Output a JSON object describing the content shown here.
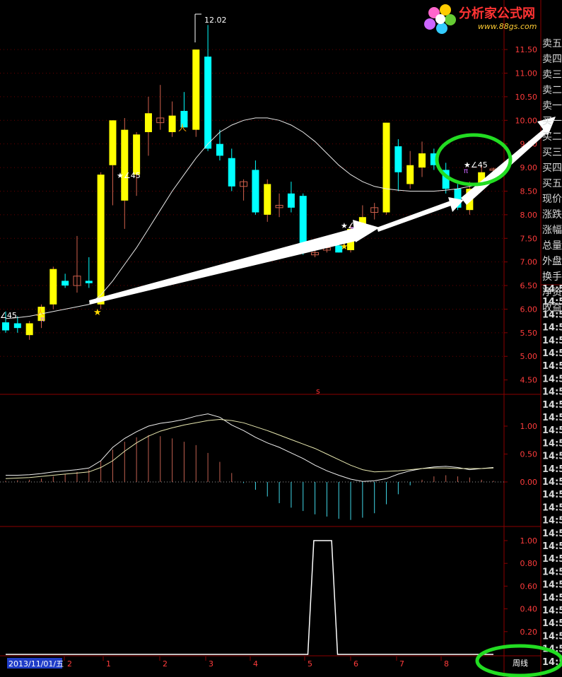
{
  "logo": {
    "title": "分析家公式网",
    "url": "www.88gs.com"
  },
  "price_axis": {
    "labels": [
      "11.50",
      "11.00",
      "10.50",
      "10.00",
      "9.50",
      "9.00",
      "8.50",
      "8.00",
      "7.50",
      "7.00",
      "6.50",
      "6.00",
      "5.50",
      "5.00",
      "4.50"
    ]
  },
  "macd_axis": {
    "labels": [
      "1.00",
      "0.50",
      "0.00"
    ]
  },
  "signal_axis": {
    "labels": [
      "1.00",
      "0.80",
      "0.60",
      "0.40",
      "0.20"
    ]
  },
  "quote_panel": {
    "labels": [
      "卖五",
      "卖四",
      "卖三",
      "卖二",
      "卖一",
      "买一",
      "买二",
      "买三",
      "买四",
      "买五",
      "现价",
      "涨跌",
      "涨幅",
      "总量",
      "外盘",
      "换手",
      "净资",
      "收益"
    ]
  },
  "time_column": {
    "label": "14:5",
    "count": 30
  },
  "annotations": {
    "high_price": "12.02",
    "angle_marks": [
      "∠45",
      "∠45",
      "∠45",
      "∠45"
    ],
    "s_marker": "s"
  },
  "time_axis": {
    "date_label": "2013/11/01/五",
    "ticks": [
      "1",
      "2",
      "1",
      "2",
      "3",
      "4",
      "5",
      "6",
      "7",
      "8"
    ]
  },
  "period_button": "周线",
  "colors": {
    "up": "#ffff00",
    "down": "#00ffff",
    "grid": "#8b0000",
    "axis_text": "#ff3c3c",
    "highlight": "#22dd22"
  },
  "chart_data": [
    {
      "type": "candlestick",
      "title": "",
      "ylim": [
        4.3,
        11.8
      ],
      "candles": [
        {
          "o": 5.72,
          "h": 5.95,
          "l": 5.5,
          "c": 5.55
        },
        {
          "o": 5.7,
          "h": 5.85,
          "l": 5.5,
          "c": 5.6
        },
        {
          "o": 5.45,
          "h": 5.75,
          "l": 5.35,
          "c": 5.7
        },
        {
          "o": 5.75,
          "h": 6.1,
          "l": 5.6,
          "c": 6.05
        },
        {
          "o": 6.1,
          "h": 6.9,
          "l": 6.0,
          "c": 6.85
        },
        {
          "o": 6.6,
          "h": 6.75,
          "l": 6.45,
          "c": 6.5
        },
        {
          "o": 6.5,
          "h": 7.55,
          "l": 6.35,
          "c": 6.7
        },
        {
          "o": 6.6,
          "h": 7.1,
          "l": 6.45,
          "c": 6.55
        },
        {
          "o": 6.1,
          "h": 8.9,
          "l": 6.0,
          "c": 8.85
        },
        {
          "o": 9.05,
          "h": 10.0,
          "l": 8.2,
          "c": 10.0
        },
        {
          "o": 8.3,
          "h": 10.05,
          "l": 7.7,
          "c": 9.8
        },
        {
          "o": 8.85,
          "h": 9.75,
          "l": 8.4,
          "c": 9.7
        },
        {
          "o": 9.75,
          "h": 10.5,
          "l": 9.25,
          "c": 10.15
        },
        {
          "o": 9.95,
          "h": 10.75,
          "l": 9.8,
          "c": 10.05
        },
        {
          "o": 9.75,
          "h": 10.4,
          "l": 9.65,
          "c": 10.1
        },
        {
          "o": 10.2,
          "h": 10.6,
          "l": 9.85,
          "c": 9.85
        },
        {
          "o": 9.8,
          "h": 11.5,
          "l": 9.65,
          "c": 11.5
        },
        {
          "o": 11.35,
          "h": 12.02,
          "l": 9.35,
          "c": 9.4
        },
        {
          "o": 9.5,
          "h": 9.8,
          "l": 9.15,
          "c": 9.25
        },
        {
          "o": 9.2,
          "h": 9.4,
          "l": 8.5,
          "c": 8.6
        },
        {
          "o": 8.6,
          "h": 8.75,
          "l": 8.3,
          "c": 8.7
        },
        {
          "o": 8.95,
          "h": 9.15,
          "l": 8.0,
          "c": 8.05
        },
        {
          "o": 8.0,
          "h": 8.75,
          "l": 7.85,
          "c": 8.65
        },
        {
          "o": 8.15,
          "h": 8.45,
          "l": 7.95,
          "c": 8.2
        },
        {
          "o": 8.45,
          "h": 8.7,
          "l": 8.05,
          "c": 8.15
        },
        {
          "o": 8.4,
          "h": 8.45,
          "l": 7.15,
          "c": 7.3
        },
        {
          "o": 7.15,
          "h": 7.25,
          "l": 7.1,
          "c": 7.2
        },
        {
          "o": 7.25,
          "h": 7.55,
          "l": 7.2,
          "c": 7.3
        },
        {
          "o": 7.35,
          "h": 7.6,
          "l": 7.2,
          "c": 7.2
        },
        {
          "o": 7.25,
          "h": 7.8,
          "l": 7.2,
          "c": 7.7
        },
        {
          "o": 7.7,
          "h": 8.2,
          "l": 7.6,
          "c": 7.95
        },
        {
          "o": 8.05,
          "h": 8.25,
          "l": 7.9,
          "c": 8.15
        },
        {
          "o": 8.05,
          "h": 9.95,
          "l": 8.0,
          "c": 9.95
        },
        {
          "o": 9.45,
          "h": 9.6,
          "l": 8.5,
          "c": 8.9
        },
        {
          "o": 8.65,
          "h": 9.35,
          "l": 8.55,
          "c": 9.05
        },
        {
          "o": 9.0,
          "h": 9.55,
          "l": 8.8,
          "c": 9.3
        },
        {
          "o": 9.3,
          "h": 9.4,
          "l": 8.95,
          "c": 9.05
        },
        {
          "o": 8.95,
          "h": 9.1,
          "l": 8.45,
          "c": 8.55
        },
        {
          "o": 8.55,
          "h": 8.65,
          "l": 8.1,
          "c": 8.15
        },
        {
          "o": 8.1,
          "h": 8.7,
          "l": 8.0,
          "c": 8.55
        },
        {
          "o": 8.65,
          "h": 9.05,
          "l": 8.5,
          "c": 8.9
        },
        {
          "o": 8.95,
          "h": 9.0,
          "l": 8.9,
          "c": 8.97
        }
      ],
      "ma": [
        5.8,
        5.82,
        5.85,
        5.9,
        5.95,
        6.0,
        6.05,
        6.1,
        6.3,
        6.6,
        6.95,
        7.3,
        7.7,
        8.1,
        8.5,
        8.85,
        9.2,
        9.5,
        9.75,
        9.9,
        10.0,
        10.05,
        10.05,
        10.0,
        9.9,
        9.75,
        9.55,
        9.3,
        9.05,
        8.85,
        8.7,
        8.6,
        8.55,
        8.52,
        8.5,
        8.5,
        8.5,
        8.52,
        8.55,
        8.6,
        8.65,
        8.7
      ]
    },
    {
      "type": "bar",
      "title": "",
      "ylim": [
        -0.75,
        1.25
      ],
      "values": [
        0.02,
        0.03,
        0.04,
        0.06,
        0.1,
        0.14,
        0.18,
        0.22,
        0.38,
        0.58,
        0.72,
        0.8,
        0.84,
        0.82,
        0.78,
        0.72,
        0.66,
        0.52,
        0.36,
        0.16,
        -0.02,
        -0.14,
        -0.26,
        -0.38,
        -0.46,
        -0.52,
        -0.58,
        -0.62,
        -0.66,
        -0.68,
        -0.64,
        -0.56,
        -0.4,
        -0.22,
        -0.06,
        0.04,
        0.1,
        0.12,
        0.1,
        0.08,
        0.04,
        0.02
      ],
      "dif": [
        0.12,
        0.12,
        0.13,
        0.15,
        0.18,
        0.2,
        0.22,
        0.25,
        0.38,
        0.62,
        0.78,
        0.9,
        1.0,
        1.05,
        1.08,
        1.12,
        1.18,
        1.22,
        1.16,
        1.02,
        0.92,
        0.8,
        0.7,
        0.62,
        0.52,
        0.42,
        0.3,
        0.2,
        0.12,
        0.05,
        0.01,
        0.02,
        0.06,
        0.14,
        0.2,
        0.24,
        0.27,
        0.28,
        0.26,
        0.22,
        0.24,
        0.26
      ],
      "dea": [
        0.06,
        0.07,
        0.08,
        0.1,
        0.12,
        0.14,
        0.16,
        0.18,
        0.26,
        0.38,
        0.55,
        0.7,
        0.82,
        0.91,
        0.97,
        1.02,
        1.06,
        1.1,
        1.12,
        1.1,
        1.06,
        0.99,
        0.92,
        0.84,
        0.76,
        0.68,
        0.6,
        0.5,
        0.4,
        0.3,
        0.22,
        0.18,
        0.19,
        0.2,
        0.22,
        0.24,
        0.25,
        0.25,
        0.24,
        0.24,
        0.24,
        0.25
      ]
    },
    {
      "type": "line",
      "title": "",
      "ylim": [
        0,
        1.1
      ],
      "values": [
        0,
        0,
        0,
        0,
        0,
        0,
        0,
        0,
        0,
        0,
        0,
        0,
        0,
        0,
        0,
        0,
        0,
        0,
        0,
        0,
        0,
        0,
        0,
        0,
        0,
        0,
        1,
        1,
        0,
        0,
        0,
        0,
        0,
        0,
        0,
        0,
        0,
        0,
        0,
        0,
        0,
        0
      ]
    }
  ]
}
